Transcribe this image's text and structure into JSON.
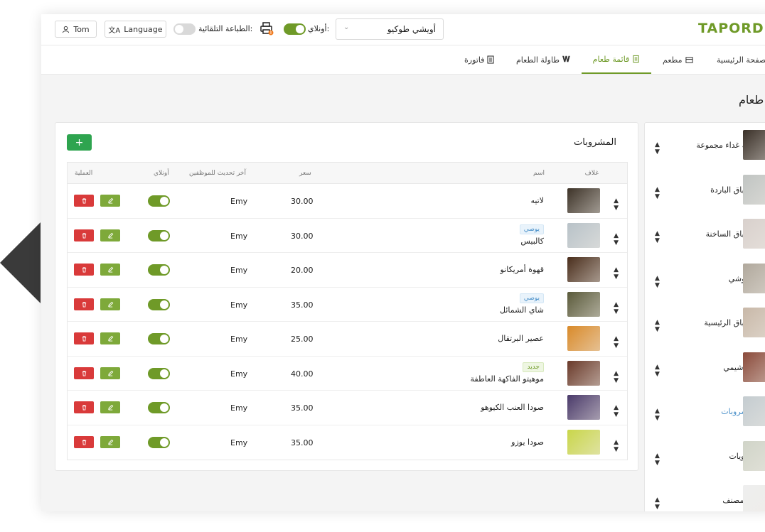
{
  "header": {
    "logo": "TAPORDI",
    "user_label": "Tom",
    "language_label": "Language",
    "auto_print_label": "الطباعة التلقائية:",
    "online_label": "أونلاي:",
    "store_select_value": "أويشي طوكيو"
  },
  "nav": {
    "items": [
      {
        "label": "الصفحة الرئيسية"
      },
      {
        "label": "مطعم"
      },
      {
        "label": "قائمة طعام"
      },
      {
        "label": "طاولة الطعام"
      },
      {
        "label": "فاتورة"
      }
    ]
  },
  "page": {
    "title": "قائمة طعام"
  },
  "card": {
    "title": "المشروبات",
    "add_label": "+",
    "columns": {
      "cover": "غلاف",
      "name": "اسم",
      "price": "سعر",
      "staff_update": "آخر تحديث للموظفين",
      "online": "أونلاي",
      "action": "العملية"
    },
    "rows": [
      {
        "name": "لاتيه",
        "tag": "",
        "price": "30.00",
        "staff": "Emy",
        "online": true,
        "thumb": "#3d3328"
      },
      {
        "name": "كالبيس",
        "tag": "يوصي",
        "price": "30.00",
        "staff": "Emy",
        "online": true,
        "thumb": "#b8c2c8"
      },
      {
        "name": "قهوة أمريكانو",
        "tag": "",
        "price": "20.00",
        "staff": "Emy",
        "online": true,
        "thumb": "#4a2e1c"
      },
      {
        "name": "شاي الشمائل",
        "tag": "يوصي",
        "price": "35.00",
        "staff": "Emy",
        "online": true,
        "thumb": "#5a5a3a"
      },
      {
        "name": "عصير البرتقال",
        "tag": "",
        "price": "25.00",
        "staff": "Emy",
        "online": true,
        "thumb": "#d98a2a"
      },
      {
        "name": "موهيتو الفاكهة العاطفة",
        "tag": "جديد",
        "price": "40.00",
        "staff": "Emy",
        "online": true,
        "thumb": "#6a3a2a"
      },
      {
        "name": "صودا العنب الكيوهو",
        "tag": "",
        "price": "35.00",
        "staff": "Emy",
        "online": true,
        "thumb": "#4a3a6a"
      },
      {
        "name": "صودا يوزو",
        "tag": "",
        "price": "35.00",
        "staff": "Emy",
        "online": true,
        "thumb": "#c9d64a"
      }
    ]
  },
  "categories": [
    {
      "label": "وجبة غداء مجموعة",
      "thumb": "#3a3028"
    },
    {
      "label": "الأطباق الباردة",
      "thumb": "#c0c4c2"
    },
    {
      "label": "الأطباق الساخنة",
      "thumb": "#d8d0cc"
    },
    {
      "label": "السوشي",
      "thumb": "#b0a89c"
    },
    {
      "label": "الأطباق الرئيسية",
      "thumb": "#c8b8a8"
    },
    {
      "label": "الساشيمي",
      "thumb": "#8a4a3a"
    },
    {
      "label": "المشروبات",
      "thumb": "#c4ccd0"
    },
    {
      "label": "الحلويات",
      "thumb": "#d0d4c8"
    },
    {
      "label": "غير مصنف",
      "thumb": "#eeeeee"
    }
  ],
  "colors": {
    "brand": "#6f9a28",
    "delete": "#d93a3a",
    "edit": "#7ea93a",
    "add": "#2ea44f",
    "link": "#4a90c9"
  }
}
